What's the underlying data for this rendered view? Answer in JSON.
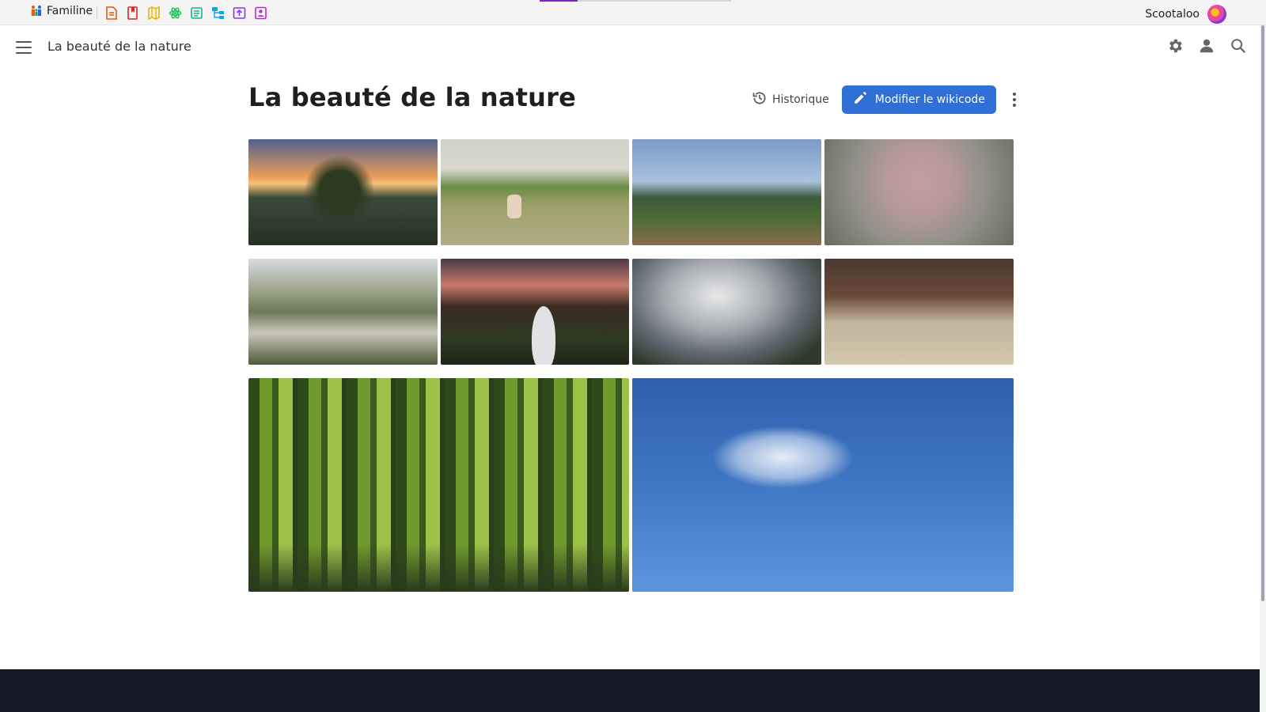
{
  "appbar": {
    "brand": "Familine",
    "apps": [
      {
        "icon": "document-icon",
        "color": "#ea580c"
      },
      {
        "icon": "bookmark-icon",
        "color": "#dc2626"
      },
      {
        "icon": "map-icon",
        "color": "#eab308"
      },
      {
        "icon": "atom-icon",
        "color": "#22c55e"
      },
      {
        "icon": "calendar-icon",
        "color": "#10b981"
      },
      {
        "icon": "sitemap-icon",
        "color": "#0ea5e9"
      },
      {
        "icon": "upload-icon",
        "color": "#7c3aed"
      },
      {
        "icon": "contact-card-icon",
        "color": "#c026d3"
      }
    ],
    "progress_fraction": 0.2,
    "username": "Scootaloo"
  },
  "pagebar": {
    "breadcrumb": "La beauté de la nature"
  },
  "page": {
    "title": "La beauté de la nature",
    "history_label": "Historique",
    "edit_label": "Modifier le wikicode"
  },
  "gallery": [
    {
      "name": "photo-sunset-houses"
    },
    {
      "name": "photo-cat-on-grass"
    },
    {
      "name": "photo-hill-view"
    },
    {
      "name": "photo-blossom-tree"
    },
    {
      "name": "photo-pond-wildflowers"
    },
    {
      "name": "photo-garden-dusk"
    },
    {
      "name": "photo-cloudy-sky"
    },
    {
      "name": "photo-dog-in-barn"
    },
    {
      "name": "photo-forest-blur"
    },
    {
      "name": "photo-blue-sky-cloud"
    }
  ],
  "colors": {
    "accent": "#2f6fd6",
    "footer": "#151a26",
    "progress": "#7e22ce"
  }
}
